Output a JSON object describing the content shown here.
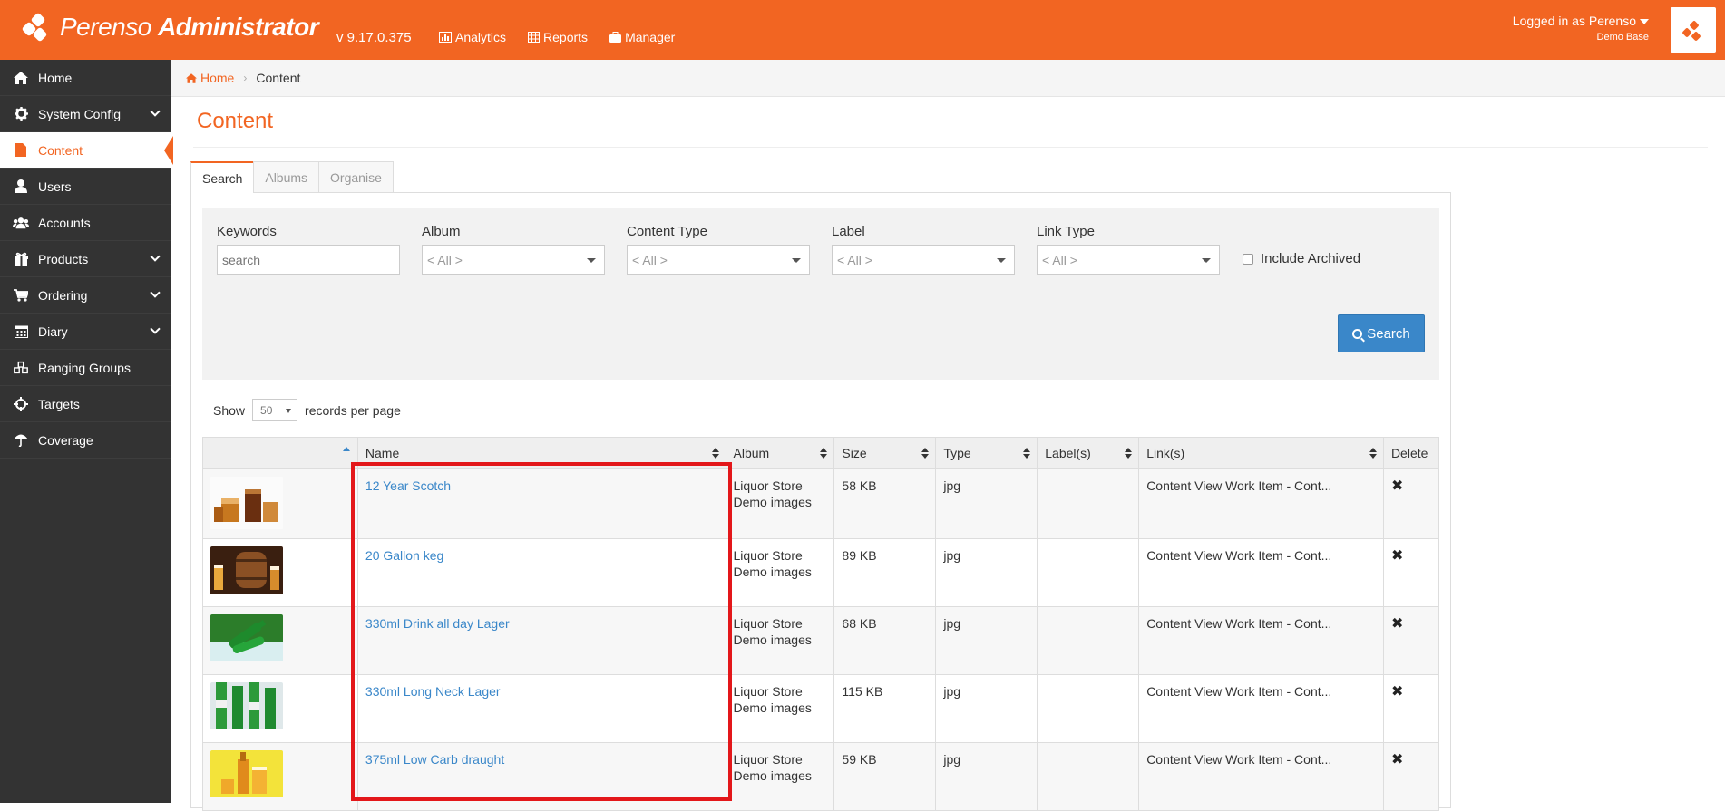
{
  "header": {
    "brand_light": "Perenso",
    "brand_bold": "Administrator",
    "version": "v 9.17.0.375",
    "nav": [
      {
        "label": "Analytics",
        "icon": "chart-icon"
      },
      {
        "label": "Reports",
        "icon": "table-icon"
      },
      {
        "label": "Manager",
        "icon": "briefcase-icon"
      }
    ],
    "user_label": "Logged in as Perenso",
    "base": "Demo Base"
  },
  "sidebar": {
    "items": [
      {
        "label": "Home",
        "icon": "home-icon",
        "expandable": false
      },
      {
        "label": "System Config",
        "icon": "gear-icon",
        "expandable": true
      },
      {
        "label": "Content",
        "icon": "file-icon",
        "expandable": false,
        "active": true
      },
      {
        "label": "Users",
        "icon": "user-icon",
        "expandable": false
      },
      {
        "label": "Accounts",
        "icon": "users-icon",
        "expandable": false
      },
      {
        "label": "Products",
        "icon": "gift-icon",
        "expandable": true
      },
      {
        "label": "Ordering",
        "icon": "cart-icon",
        "expandable": true
      },
      {
        "label": "Diary",
        "icon": "calendar-icon",
        "expandable": true
      },
      {
        "label": "Ranging Groups",
        "icon": "cubes-icon",
        "expandable": false
      },
      {
        "label": "Targets",
        "icon": "crosshairs-icon",
        "expandable": false
      },
      {
        "label": "Coverage",
        "icon": "umbrella-icon",
        "expandable": false
      }
    ]
  },
  "breadcrumb": {
    "home": "Home",
    "current": "Content"
  },
  "page": {
    "title": "Content"
  },
  "tabs": [
    "Search",
    "Albums",
    "Organise"
  ],
  "filters": {
    "keywords_label": "Keywords",
    "keywords_placeholder": "search",
    "album_label": "Album",
    "album_value": "< All >",
    "content_type_label": "Content Type",
    "content_type_value": "< All >",
    "label_label": "Label",
    "label_value": "< All >",
    "link_type_label": "Link Type",
    "link_type_value": "< All >",
    "include_archived": "Include Archived",
    "search_button": "Search"
  },
  "paging": {
    "show": "Show",
    "per_page_value": "50",
    "suffix": "records per page"
  },
  "table": {
    "headers": [
      "",
      "Name",
      "Album",
      "Size",
      "Type",
      "Label(s)",
      "Link(s)",
      "Delete"
    ],
    "rows": [
      {
        "name": "12 Year Scotch",
        "album1": "Liquor Store",
        "album2": "Demo images",
        "size": "58 KB",
        "type": "jpg",
        "labels": "",
        "links": "Content View Work Item - Cont..."
      },
      {
        "name": "20 Gallon keg",
        "album1": "Liquor Store",
        "album2": "Demo images",
        "size": "89 KB",
        "type": "jpg",
        "labels": "",
        "links": "Content View Work Item - Cont..."
      },
      {
        "name": "330ml Drink all day Lager",
        "album1": "Liquor Store",
        "album2": "Demo images",
        "size": "68 KB",
        "type": "jpg",
        "labels": "",
        "links": "Content View Work Item - Cont..."
      },
      {
        "name": "330ml Long Neck Lager",
        "album1": "Liquor Store",
        "album2": "Demo images",
        "size": "115 KB",
        "type": "jpg",
        "labels": "",
        "links": "Content View Work Item - Cont..."
      },
      {
        "name": "375ml Low Carb draught",
        "album1": "Liquor Store",
        "album2": "Demo images",
        "size": "59 KB",
        "type": "jpg",
        "labels": "",
        "links": "Content View Work Item - Cont..."
      }
    ]
  },
  "colors": {
    "brand": "#f26522",
    "link": "#3a87c9",
    "sidebar": "#333333",
    "highlight": "#e3171a"
  }
}
